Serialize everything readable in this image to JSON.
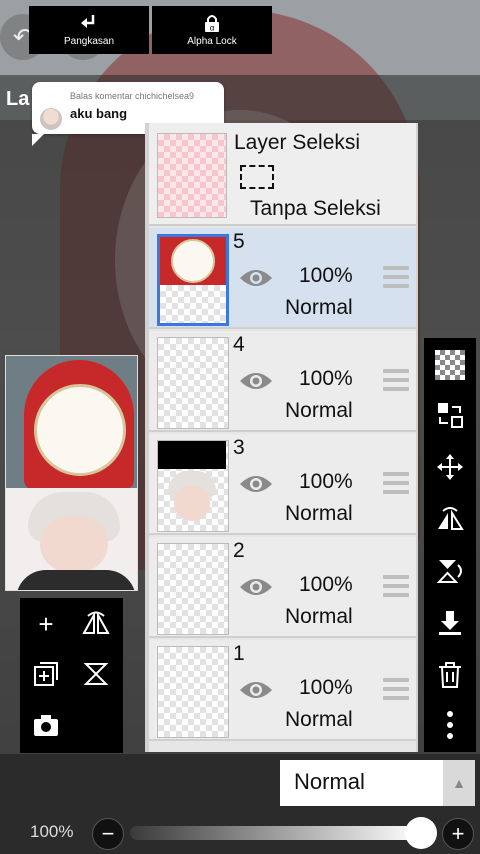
{
  "top": {
    "back_icon": "back-arrow-icon",
    "title_fragment": "La"
  },
  "comment": {
    "header": "Balas komentar chichichelsea9",
    "message": "aku bang"
  },
  "layers_panel": {
    "selection_layer": {
      "title": "Layer Seleksi",
      "subtitle": "Tanpa Seleksi"
    },
    "layers": [
      {
        "number": "5",
        "opacity": "100%",
        "mode": "Normal",
        "active": true
      },
      {
        "number": "4",
        "opacity": "100%",
        "mode": "Normal",
        "active": false
      },
      {
        "number": "3",
        "opacity": "100%",
        "mode": "Normal",
        "active": false
      },
      {
        "number": "2",
        "opacity": "100%",
        "mode": "Normal",
        "active": false
      },
      {
        "number": "1",
        "opacity": "100%",
        "mode": "Normal",
        "active": false
      }
    ]
  },
  "right_tools": [
    "checker-icon",
    "swap-layer-icon",
    "move-icon",
    "flip-horizontal-icon",
    "flip-vertical-icon",
    "merge-down-icon",
    "trash-icon",
    "more-icon"
  ],
  "left_tools": [
    "add-layer-icon",
    "flip-icon",
    "copy-layer-icon",
    "rotate-icon",
    "camera-icon"
  ],
  "bottom": {
    "clip_label": "Pangkasan",
    "alpha_lock_label": "Alpha Lock",
    "blend_mode": "Normal",
    "zoom": "100%",
    "minus": "−",
    "plus": "+"
  },
  "colors": {
    "active_layer_bg": "#d6e1f0",
    "active_border": "#3a78e0"
  }
}
